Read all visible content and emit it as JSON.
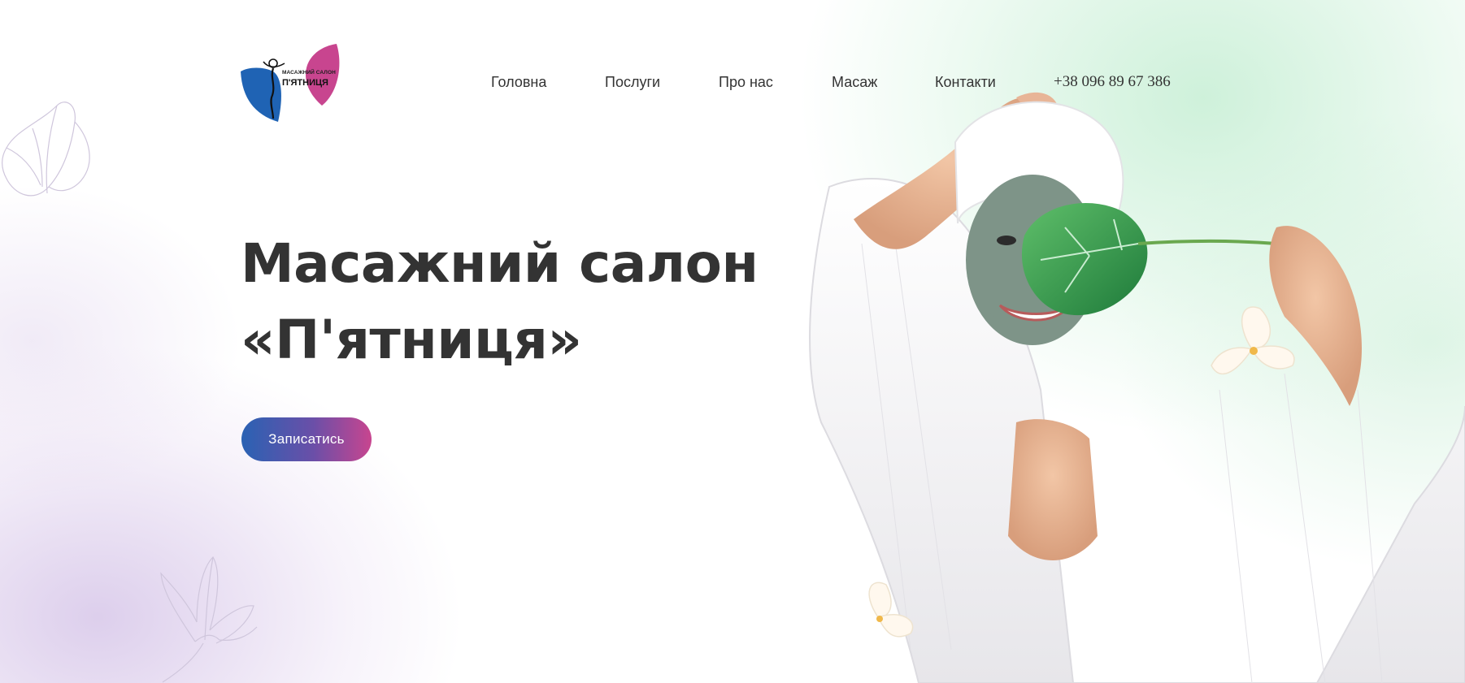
{
  "header": {
    "logo": {
      "small_text": "МАСАЖНИЙ САЛОН",
      "big_text": "П'ЯТНИЦЯ",
      "icon": "woman-silhouette-logo-icon"
    },
    "nav": [
      {
        "label": "Головна"
      },
      {
        "label": "Послуги"
      },
      {
        "label": "Про нас"
      },
      {
        "label": "Масаж"
      },
      {
        "label": "Контакти"
      }
    ],
    "phone": "+38 096 89 67 386"
  },
  "hero": {
    "title_line1": "Масажний салон",
    "title_line2": "«П'ятниця»",
    "cta_label": "Записатись",
    "image": "woman-with-face-mask-and-leaf"
  },
  "colors": {
    "text": "#333333",
    "brand_blue": "#1f63b4",
    "brand_pink": "#c8458f",
    "mint": "#bfead0",
    "lavender": "#d7c8ea"
  }
}
